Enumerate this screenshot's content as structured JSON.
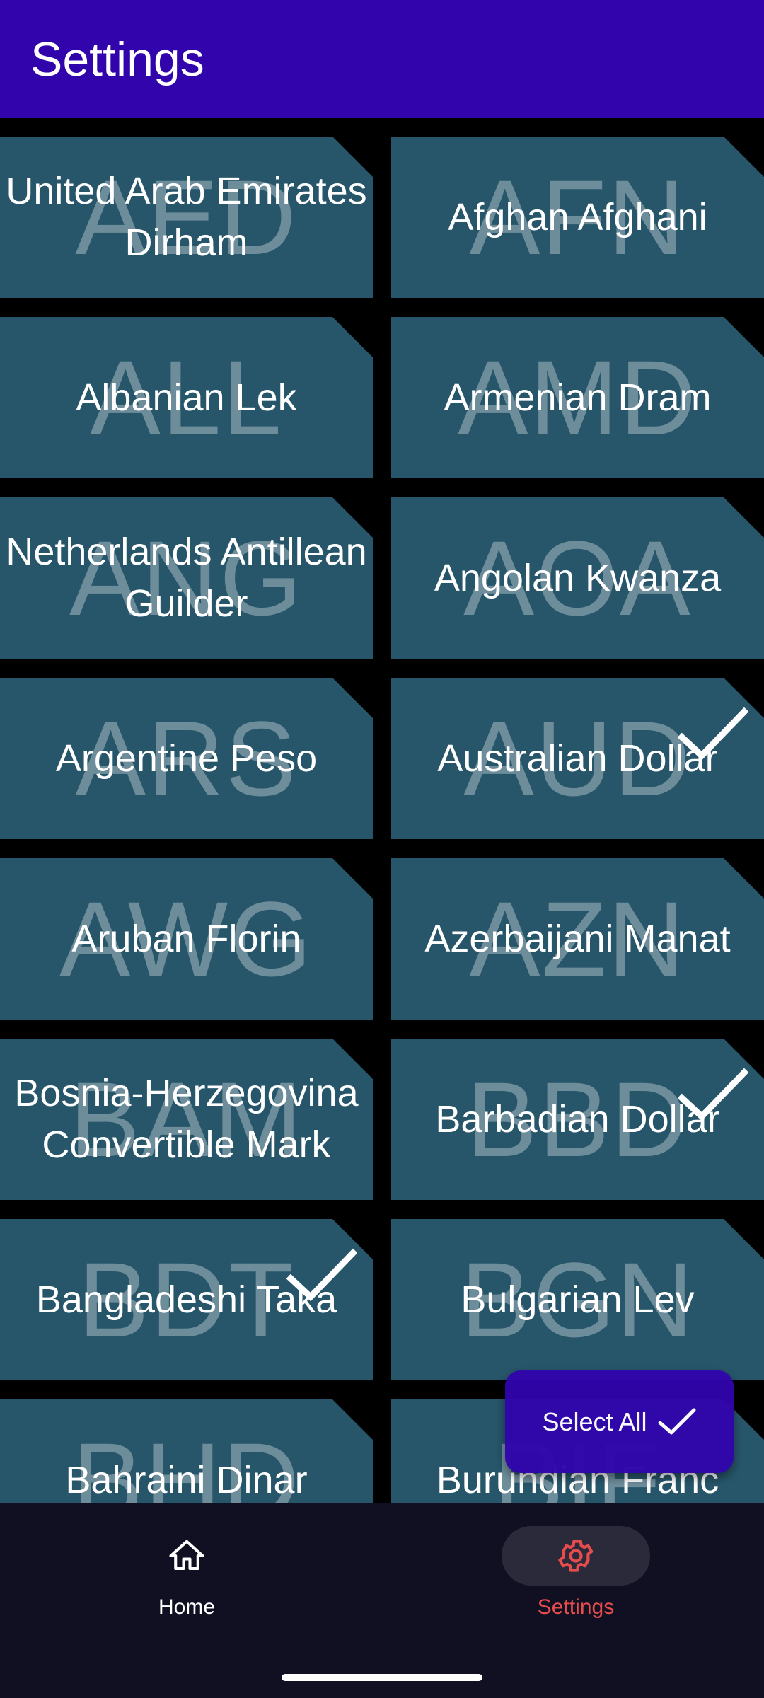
{
  "appbar": {
    "title": "Settings",
    "color": "#3105ab"
  },
  "tile_color": "#27566a",
  "currencies": [
    {
      "code": "AED",
      "name": "United Arab Emirates Dirham",
      "selected": false
    },
    {
      "code": "AFN",
      "name": "Afghan Afghani",
      "selected": false
    },
    {
      "code": "ALL",
      "name": "Albanian Lek",
      "selected": false
    },
    {
      "code": "AMD",
      "name": "Armenian Dram",
      "selected": false
    },
    {
      "code": "ANG",
      "name": "Netherlands Antillean Guilder",
      "selected": false
    },
    {
      "code": "AOA",
      "name": "Angolan Kwanza",
      "selected": false
    },
    {
      "code": "ARS",
      "name": "Argentine Peso",
      "selected": false
    },
    {
      "code": "AUD",
      "name": "Australian Dollar",
      "selected": true
    },
    {
      "code": "AWG",
      "name": "Aruban Florin",
      "selected": false
    },
    {
      "code": "AZN",
      "name": "Azerbaijani Manat",
      "selected": false
    },
    {
      "code": "BAM",
      "name": "Bosnia-Herzegovina Convertible Mark",
      "selected": false
    },
    {
      "code": "BBD",
      "name": "Barbadian Dollar",
      "selected": true
    },
    {
      "code": "BDT",
      "name": "Bangladeshi Taka",
      "selected": true
    },
    {
      "code": "BGN",
      "name": "Bulgarian Lev",
      "selected": false
    },
    {
      "code": "BHD",
      "name": "Bahraini Dinar",
      "selected": false
    },
    {
      "code": "BIF",
      "name": "Burundian Franc",
      "selected": false
    }
  ],
  "fab": {
    "label": "Select All",
    "icon": "check-icon"
  },
  "bottom_nav": [
    {
      "id": "home",
      "label": "Home",
      "icon": "home-icon",
      "active": false,
      "color": "#ffffff"
    },
    {
      "id": "settings",
      "label": "Settings",
      "icon": "gear-icon",
      "active": true,
      "color": "#e74c4c"
    }
  ]
}
